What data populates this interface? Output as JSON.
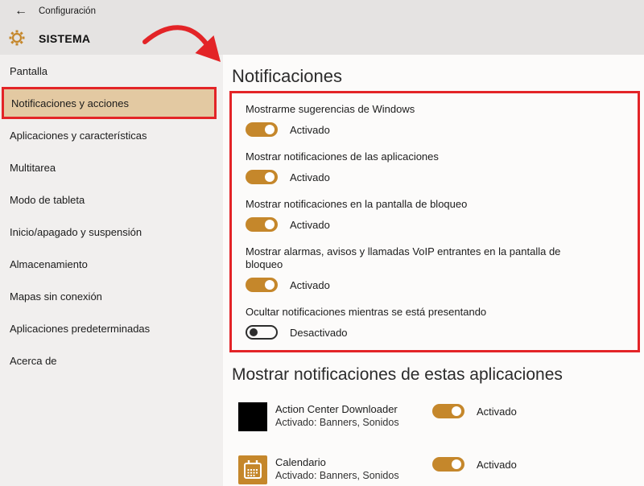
{
  "colors": {
    "accent": "#c5872b",
    "selected_highlight": "#e3c9a2",
    "annotation_red": "#e32427"
  },
  "header": {
    "back_label": "←",
    "app_title": "Configuración",
    "page_title": "SISTEMA"
  },
  "sidebar": {
    "items": [
      {
        "label": "Pantalla",
        "selected": false
      },
      {
        "label": "Notificaciones y acciones",
        "selected": true
      },
      {
        "label": "Aplicaciones y características",
        "selected": false
      },
      {
        "label": "Multitarea",
        "selected": false
      },
      {
        "label": "Modo de tableta",
        "selected": false
      },
      {
        "label": "Inicio/apagado y suspensión",
        "selected": false
      },
      {
        "label": "Almacenamiento",
        "selected": false
      },
      {
        "label": "Mapas sin conexión",
        "selected": false
      },
      {
        "label": "Aplicaciones predeterminadas",
        "selected": false
      },
      {
        "label": "Acerca de",
        "selected": false
      }
    ]
  },
  "notifications": {
    "title": "Notificaciones",
    "toggles": [
      {
        "label": "Mostrarme sugerencias de Windows",
        "state": "Activado",
        "on": true
      },
      {
        "label": "Mostrar notificaciones de las aplicaciones",
        "state": "Activado",
        "on": true
      },
      {
        "label": "Mostrar notificaciones en la pantalla de bloqueo",
        "state": "Activado",
        "on": true
      },
      {
        "label": "Mostrar alarmas, avisos y llamadas VoIP entrantes en la pantalla de bloqueo",
        "state": "Activado",
        "on": true
      },
      {
        "label": "Ocultar notificaciones mientras se está presentando",
        "state": "Desactivado",
        "on": false
      }
    ]
  },
  "apps_section": {
    "title": "Mostrar notificaciones de estas aplicaciones",
    "apps": [
      {
        "name": "Action Center Downloader",
        "detail": "Activado: Banners, Sonidos",
        "state": "Activado",
        "on": true
      },
      {
        "name": "Calendario",
        "detail": "Activado: Banners, Sonidos",
        "state": "Activado",
        "on": true
      }
    ]
  }
}
